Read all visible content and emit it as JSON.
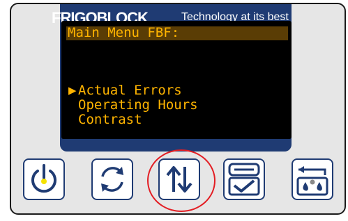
{
  "header": {
    "brand": "FRIGOBLOCK",
    "tagline": "Technology at its best"
  },
  "screen": {
    "title": "Main Menu FBF:",
    "selection_marker": "▶",
    "menu_items": [
      "Actual Errors",
      "Operating Hours",
      "Contrast"
    ],
    "selected_index": 0
  },
  "buttons": [
    {
      "name": "power-button",
      "icon": "power-icon"
    },
    {
      "name": "refresh-button",
      "icon": "refresh-icon"
    },
    {
      "name": "up-down-button",
      "icon": "up-down-arrows-icon",
      "highlighted": true
    },
    {
      "name": "settings-confirm-button",
      "icon": "wrench-check-icon"
    },
    {
      "name": "defrost-button",
      "icon": "defrost-icon"
    }
  ],
  "colors": {
    "panel": "#e6e6e6",
    "bezel": "#1f3b73",
    "lcd_text": "#ffb400",
    "highlight_ring": "#e31e24",
    "power_led": "#f5e200"
  }
}
